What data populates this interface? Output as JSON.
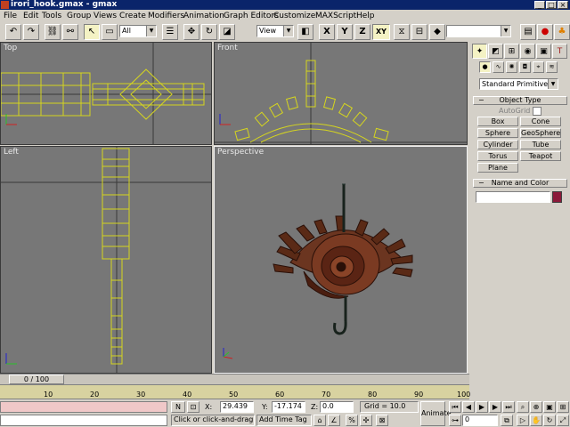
{
  "window": {
    "title": "irori_hook.gmax - gmax"
  },
  "menu": [
    "File",
    "Edit",
    "Tools",
    "Group",
    "Views",
    "Create",
    "Modifiers",
    "Animation",
    "Graph Editors",
    "Customize",
    "MAXScript",
    "Help"
  ],
  "toolbar": {
    "selection_filter": "All",
    "reference_coord": "View",
    "axis_x": "X",
    "axis_y": "Y",
    "axis_z": "Z",
    "axis_xy": "XY",
    "named_selection": ""
  },
  "viewports": {
    "top": "Top",
    "front": "Front",
    "left": "Left",
    "perspective": "Perspective"
  },
  "command_panel": {
    "category": "Standard Primitives",
    "object_type_header": "Object Type",
    "autogrid": "AutoGrid",
    "buttons": [
      "Box",
      "Cone",
      "Sphere",
      "GeoSphere",
      "Cylinder",
      "Tube",
      "Torus",
      "Teapot",
      "Plane"
    ],
    "name_color_header": "Name and Color",
    "name_value": "",
    "color": "#8b1a3a"
  },
  "timeline": {
    "slider_text": "0 / 100",
    "ticks": [
      "10",
      "20",
      "30",
      "40",
      "50",
      "60",
      "70",
      "80",
      "90",
      "100"
    ]
  },
  "status": {
    "lock_label": "N",
    "x_label": "X:",
    "x_value": "29.439",
    "y_label": "Y:",
    "y_value": "-17.174",
    "z_label": "Z:",
    "z_value": "0.0",
    "grid": "Grid = 10.0",
    "prompt": "Click or click-and-drag to",
    "add_time_tag": "Add Time Tag",
    "animate": "Animate",
    "frame": "0"
  }
}
